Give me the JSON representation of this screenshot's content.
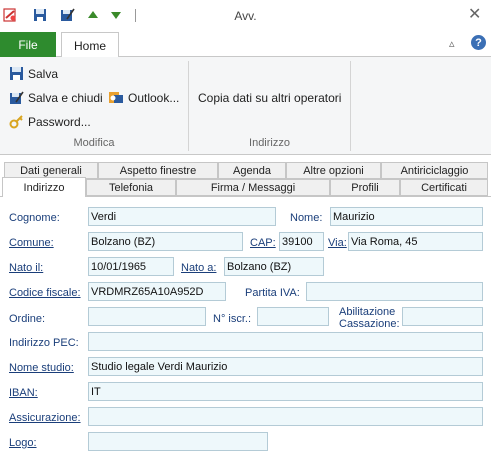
{
  "window": {
    "title": "Avv."
  },
  "ribbon": {
    "tabs": {
      "file": "File",
      "home": "Home"
    },
    "groups": {
      "modifica": {
        "label": "Modifica",
        "save": "Salva",
        "save_close": "Salva e chiudi",
        "outlook": "Outlook...",
        "password": "Password..."
      },
      "indirizzo": {
        "label": "Indirizzo",
        "copy": "Copia dati su altri operatori"
      }
    }
  },
  "panel_tabs": {
    "row1": [
      "Dati generali",
      "Aspetto finestre",
      "Agenda",
      "Altre opzioni",
      "Antiriciclaggio"
    ],
    "row2": [
      "Indirizzo",
      "Telefonia",
      "Firma / Messaggi",
      "Profili",
      "Certificati"
    ]
  },
  "form": {
    "cognome": {
      "label": "Cognome:",
      "value": "Verdi"
    },
    "nome": {
      "label": "Nome:",
      "value": "Maurizio"
    },
    "comune": {
      "label": "Comune:",
      "value": "Bolzano (BZ)"
    },
    "cap": {
      "label": "CAP:",
      "value": "39100"
    },
    "via": {
      "label": "Via:",
      "value": "Via Roma, 45"
    },
    "nato_il": {
      "label": "Nato il:",
      "value": "10/01/1965"
    },
    "nato_a": {
      "label": "Nato a:",
      "value": "Bolzano (BZ)"
    },
    "codice_fiscale": {
      "label": "Codice fiscale:",
      "value": "VRDMRZ65A10A952D"
    },
    "partita_iva": {
      "label": "Partita IVA:",
      "value": ""
    },
    "ordine": {
      "label": "Ordine:",
      "value": ""
    },
    "n_iscr": {
      "label": "N° iscr.:",
      "value": ""
    },
    "abilitazione": {
      "label_line1": "Abilitazione",
      "label_line2": "Cassazione:",
      "value": ""
    },
    "pec": {
      "label": "Indirizzo PEC:",
      "value": ""
    },
    "nome_studio": {
      "label": "Nome studio:",
      "value": "Studio legale Verdi Maurizio"
    },
    "iban": {
      "label": "IBAN:",
      "value": "IT"
    },
    "assicurazione": {
      "label": "Assicurazione:",
      "value": ""
    },
    "logo": {
      "label": "Logo:",
      "value": ""
    }
  }
}
